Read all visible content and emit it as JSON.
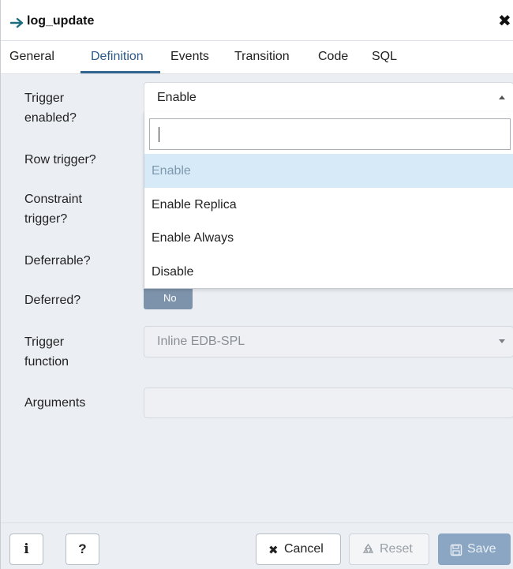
{
  "dialog": {
    "title": "log_update",
    "close_glyph": "✖"
  },
  "tabs": [
    {
      "label": "General"
    },
    {
      "label": "Definition",
      "active": true
    },
    {
      "label": "Events"
    },
    {
      "label": "Transition"
    },
    {
      "label": "Code"
    },
    {
      "label": "SQL"
    }
  ],
  "form": {
    "trigger_enabled": {
      "label_line1": "Trigger",
      "label_line2": "enabled?",
      "value": "Enable",
      "search_value": "",
      "options": [
        "Enable",
        "Enable Replica",
        "Enable Always",
        "Disable"
      ],
      "highlighted_option": "Enable"
    },
    "row_trigger": {
      "label": "Row trigger?"
    },
    "constraint_trigger": {
      "label_line1": "Constraint",
      "label_line2": "trigger?"
    },
    "deferrable": {
      "label": "Deferrable?"
    },
    "deferred": {
      "label": "Deferred?",
      "value": "No"
    },
    "trigger_function": {
      "label_line1": "Trigger",
      "label_line2": "function",
      "value": "Inline EDB-SPL"
    },
    "arguments": {
      "label": "Arguments",
      "value": ""
    }
  },
  "footer": {
    "info_label": "i",
    "help_label": "?",
    "cancel_label": "Cancel",
    "reset_label": "Reset",
    "save_label": "Save"
  },
  "colors": {
    "accent": "#326690",
    "highlight": "#d6ebf7",
    "toggle_off": "#7d93ab",
    "save_button": "#8aa6c2"
  },
  "icons": [
    "arrow-right-icon",
    "close-icon",
    "caret-up-icon",
    "caret-down-icon",
    "info-icon",
    "help-icon",
    "x-icon",
    "recycle-icon",
    "save-icon"
  ]
}
